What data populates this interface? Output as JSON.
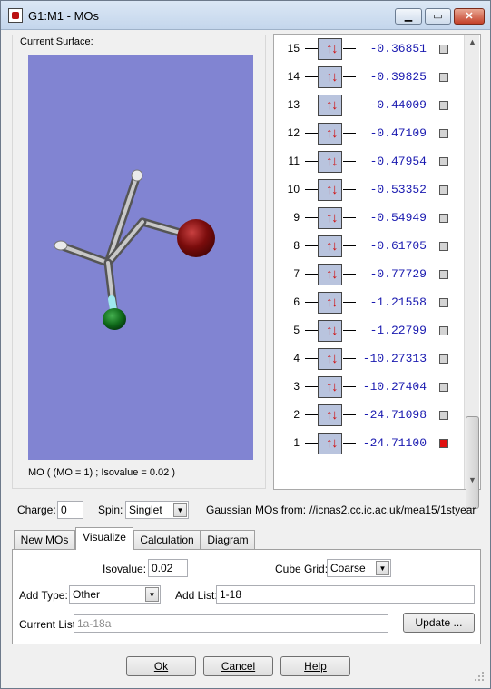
{
  "window": {
    "title": "G1:M1 - MOs"
  },
  "left_panel": {
    "current_surface_label": "Current Surface:",
    "mo_caption": "MO ( (MO = 1) ; Isovalue = 0.02 )"
  },
  "orbitals": [
    {
      "num": "15",
      "energy": "-0.36851",
      "selected": false
    },
    {
      "num": "14",
      "energy": "-0.39825",
      "selected": false
    },
    {
      "num": "13",
      "energy": "-0.44009",
      "selected": false
    },
    {
      "num": "12",
      "energy": "-0.47109",
      "selected": false
    },
    {
      "num": "11",
      "energy": "-0.47954",
      "selected": false
    },
    {
      "num": "10",
      "energy": "-0.53352",
      "selected": false
    },
    {
      "num": "9",
      "energy": "-0.54949",
      "selected": false
    },
    {
      "num": "8",
      "energy": "-0.61705",
      "selected": false
    },
    {
      "num": "7",
      "energy": "-0.77729",
      "selected": false
    },
    {
      "num": "6",
      "energy": "-1.21558",
      "selected": false
    },
    {
      "num": "5",
      "energy": "-1.22799",
      "selected": false
    },
    {
      "num": "4",
      "energy": "-10.27313",
      "selected": false
    },
    {
      "num": "3",
      "energy": "-10.27404",
      "selected": false
    },
    {
      "num": "2",
      "energy": "-24.71098",
      "selected": false
    },
    {
      "num": "1",
      "energy": "-24.71100",
      "selected": true
    }
  ],
  "info_row": {
    "charge_label": "Charge:",
    "charge_value": "0",
    "spin_label": "Spin:",
    "spin_value": "Singlet",
    "source_label": "Gaussian MOs from:",
    "source_value": "//icnas2.cc.ic.ac.uk/mea15/1styear"
  },
  "tabs": [
    {
      "label": "New MOs",
      "active": false
    },
    {
      "label": "Visualize",
      "active": true
    },
    {
      "label": "Calculation",
      "active": false
    },
    {
      "label": "Diagram",
      "active": false
    }
  ],
  "visualize": {
    "isovalue_label": "Isovalue:",
    "isovalue_value": "0.02",
    "cube_grid_label": "Cube Grid:",
    "cube_grid_value": "Coarse",
    "add_type_label": "Add Type:",
    "add_type_value": "Other",
    "add_list_label": "Add List:",
    "add_list_value": "1-18",
    "current_list_label": "Current List:",
    "current_list_value": "1a-18a",
    "update_label": "Update ..."
  },
  "buttons": {
    "ok": "Ok",
    "cancel": "Cancel",
    "help": "Help"
  },
  "colors": {
    "viewer_background": "#8184d2",
    "energy_text": "#1a1ab0",
    "electron_arrows": "#d01010",
    "selected_marker": "#e01010",
    "orbital_box": "#b9c4de"
  }
}
